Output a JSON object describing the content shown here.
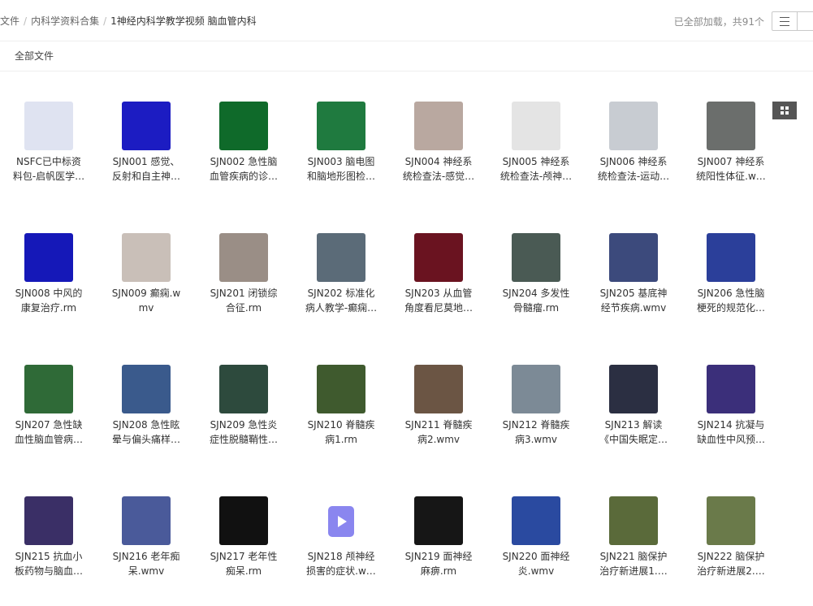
{
  "breadcrumb": [
    "文件",
    "内科学资料合集",
    "1神经内科学教学视频 脑血管内科"
  ],
  "status": "已全部加载，共91个",
  "subheader": {
    "all_files": "全部文件"
  },
  "view_toggle": {
    "list": "list-icon",
    "grid": "grid-icon"
  },
  "files": [
    {
      "line1": "NSFC已中标资",
      "line2": "料包-启帆医学…",
      "thumb": "#dfe3f1"
    },
    {
      "line1": "SJN001 感觉、",
      "line2": "反射和自主神…",
      "thumb": "#1c1cc2"
    },
    {
      "line1": "SJN002 急性脑",
      "line2": "血管疾病的诊…",
      "thumb": "#0f6a2a"
    },
    {
      "line1": "SJN003 脑电图",
      "line2": "和脑地形图检…",
      "thumb": "#1f7a3f"
    },
    {
      "line1": "SJN004 神经系",
      "line2": "统检查法-感觉…",
      "thumb": "#b9a8a0"
    },
    {
      "line1": "SJN005 神经系",
      "line2": "统检查法-颅神…",
      "thumb": "#e4e4e4"
    },
    {
      "line1": "SJN006 神经系",
      "line2": "统检查法-运动…",
      "thumb": "#c8ccd2"
    },
    {
      "line1": "SJN007 神经系",
      "line2": "统阳性体征.w…",
      "thumb": "#6b6e6c"
    },
    {
      "line1": "SJN008 中风的",
      "line2": "康复治疗.rm",
      "thumb": "#1518b8"
    },
    {
      "line1": "SJN009 癫痫.w",
      "line2": "mv",
      "thumb": "#c9bfb8"
    },
    {
      "line1": "SJN201 闭锁综",
      "line2": "合征.rm",
      "thumb": "#9a8e86"
    },
    {
      "line1": "SJN202 标准化",
      "line2": "病人教学-癫痫…",
      "thumb": "#5b6b78"
    },
    {
      "line1": "SJN203 从血管",
      "line2": "角度看尼莫地…",
      "thumb": "#6a1320"
    },
    {
      "line1": "SJN204 多发性",
      "line2": "骨髓瘤.rm",
      "thumb": "#4a5a54"
    },
    {
      "line1": "SJN205 基底神",
      "line2": "经节疾病.wmv",
      "thumb": "#3c4a7c"
    },
    {
      "line1": "SJN206 急性脑",
      "line2": "梗死的规范化…",
      "thumb": "#2b3f9a"
    },
    {
      "line1": "SJN207 急性缺",
      "line2": "血性脑血管病…",
      "thumb": "#2f6a37"
    },
    {
      "line1": "SJN208 急性眩",
      "line2": "晕与偏头痛样…",
      "thumb": "#3a5a8c"
    },
    {
      "line1": "SJN209 急性炎",
      "line2": "症性脱髓鞘性…",
      "thumb": "#2d4a3d"
    },
    {
      "line1": "SJN210 脊髓疾",
      "line2": "病1.rm",
      "thumb": "#3f5a2e"
    },
    {
      "line1": "SJN211 脊髓疾",
      "line2": "病2.wmv",
      "thumb": "#6b5544"
    },
    {
      "line1": "SJN212 脊髓疾",
      "line2": "病3.wmv",
      "thumb": "#7c8a96"
    },
    {
      "line1": "SJN213 解读",
      "line2": "《中国失眠定…",
      "thumb": "#2b2f42"
    },
    {
      "line1": "SJN214 抗凝与",
      "line2": "缺血性中风预…",
      "thumb": "#3b2f7a"
    },
    {
      "line1": "SJN215 抗血小",
      "line2": "板药物与脑血…",
      "thumb": "#3a2f66"
    },
    {
      "line1": "SJN216 老年痴",
      "line2": "呆.wmv",
      "thumb": "#4a5a9a"
    },
    {
      "line1": "SJN217 老年性",
      "line2": "痴呆.rm",
      "thumb": "#111111"
    },
    {
      "line1": "SJN218 颅神经",
      "line2": "损害的症状.w…",
      "thumb": "video"
    },
    {
      "line1": "SJN219 面神经",
      "line2": "麻痹.rm",
      "thumb": "#161616"
    },
    {
      "line1": "SJN220 面神经",
      "line2": "炎.wmv",
      "thumb": "#2a4aa0"
    },
    {
      "line1": "SJN221 脑保护",
      "line2": "治疗新进展1.…",
      "thumb": "#5a6a3a"
    },
    {
      "line1": "SJN222 脑保护",
      "line2": "治疗新进展2.…",
      "thumb": "#6a7a4a"
    }
  ]
}
